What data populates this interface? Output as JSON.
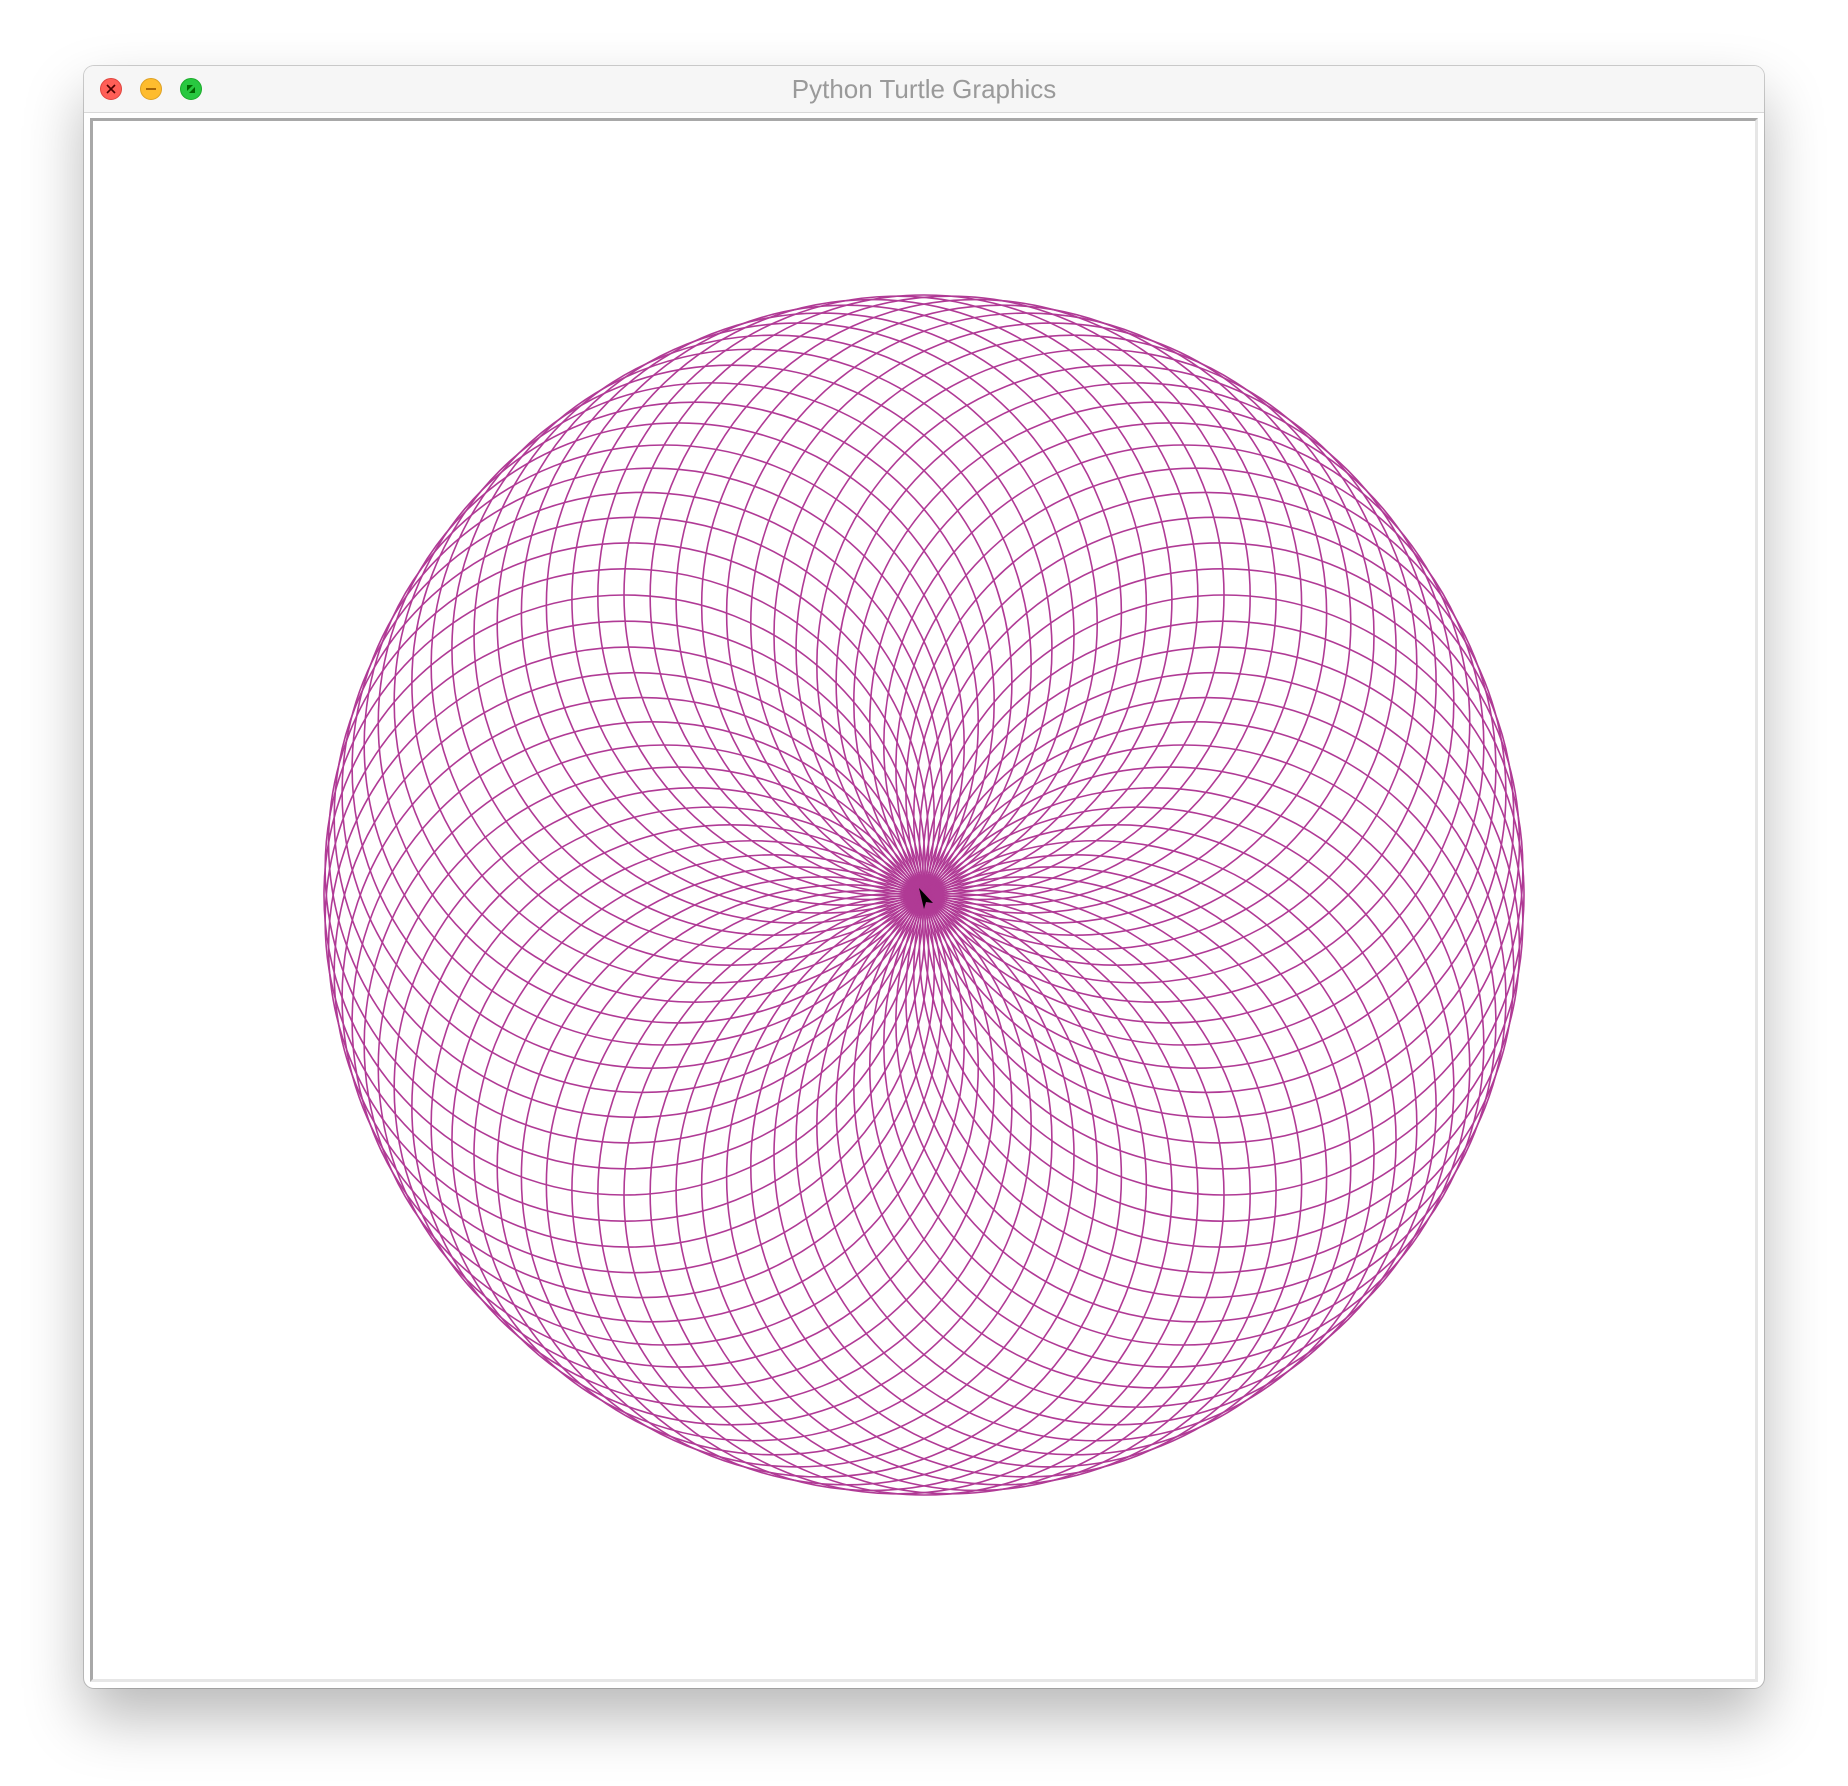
{
  "window": {
    "title": "Python Turtle Graphics"
  },
  "controls": {
    "close_icon": "close-icon",
    "minimize_icon": "minimize-icon",
    "fullscreen_icon": "fullscreen-icon"
  },
  "drawing": {
    "pen_color": "#b03a95",
    "background_color": "#ffffff",
    "turtle_color": "#000000",
    "circle_count": 72,
    "angle_step_degrees": 5
  }
}
